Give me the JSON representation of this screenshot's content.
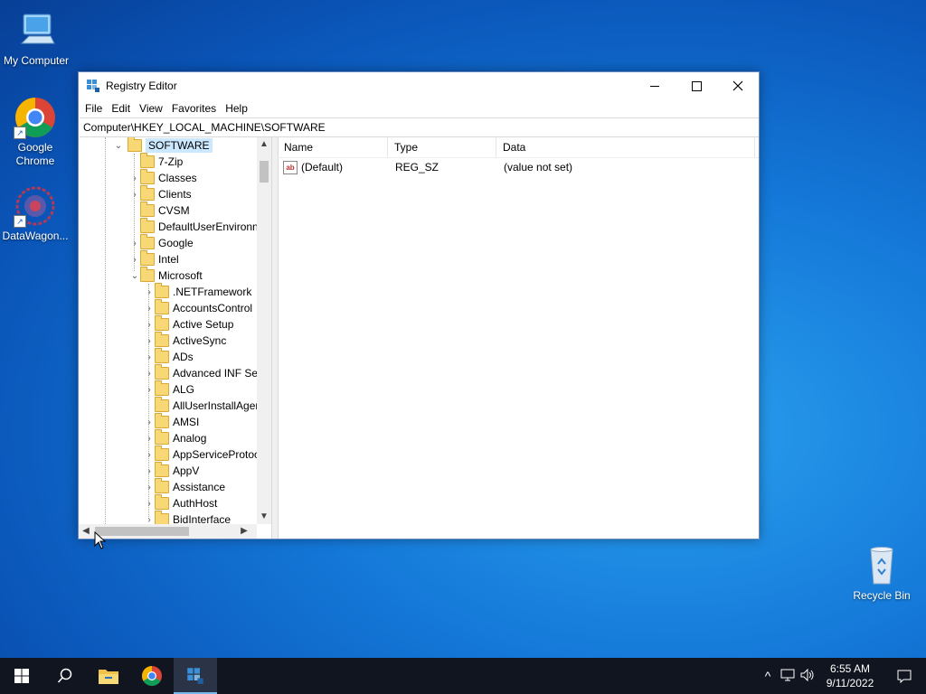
{
  "desktop": {
    "icons": [
      {
        "label": "My Computer"
      },
      {
        "label": "Google Chrome"
      },
      {
        "label": "DataWagon..."
      },
      {
        "label": "Recycle Bin"
      }
    ]
  },
  "window": {
    "title": "Registry Editor",
    "menu": [
      "File",
      "Edit",
      "View",
      "Favorites",
      "Help"
    ],
    "address": "Computer\\HKEY_LOCAL_MACHINE\\SOFTWARE",
    "tree": {
      "selected": "SOFTWARE",
      "items": [
        {
          "label": "SOFTWARE",
          "expanded": true
        },
        {
          "label": "7-Zip"
        },
        {
          "label": "Classes"
        },
        {
          "label": "Clients"
        },
        {
          "label": "CVSM"
        },
        {
          "label": "DefaultUserEnvironn"
        },
        {
          "label": "Google"
        },
        {
          "label": "Intel"
        },
        {
          "label": "Microsoft",
          "expanded": true
        },
        {
          "label": ".NETFramework"
        },
        {
          "label": "AccountsControl"
        },
        {
          "label": "Active Setup"
        },
        {
          "label": "ActiveSync"
        },
        {
          "label": "ADs"
        },
        {
          "label": "Advanced INF Set"
        },
        {
          "label": "ALG"
        },
        {
          "label": "AllUserInstallAger"
        },
        {
          "label": "AMSI"
        },
        {
          "label": "Analog"
        },
        {
          "label": "AppServiceProtoc"
        },
        {
          "label": "AppV"
        },
        {
          "label": "Assistance"
        },
        {
          "label": "AuthHost"
        },
        {
          "label": "BidInterface"
        }
      ]
    },
    "list": {
      "columns": [
        "Name",
        "Type",
        "Data"
      ],
      "rows": [
        {
          "name": "(Default)",
          "type": "REG_SZ",
          "data": "(value not set)"
        }
      ]
    }
  },
  "taskbar": {
    "time": "6:55 AM",
    "date": "9/11/2022"
  },
  "colors": {
    "selection": "#cce8ff",
    "folder": "#f8d775",
    "taskbar": "#101520"
  }
}
